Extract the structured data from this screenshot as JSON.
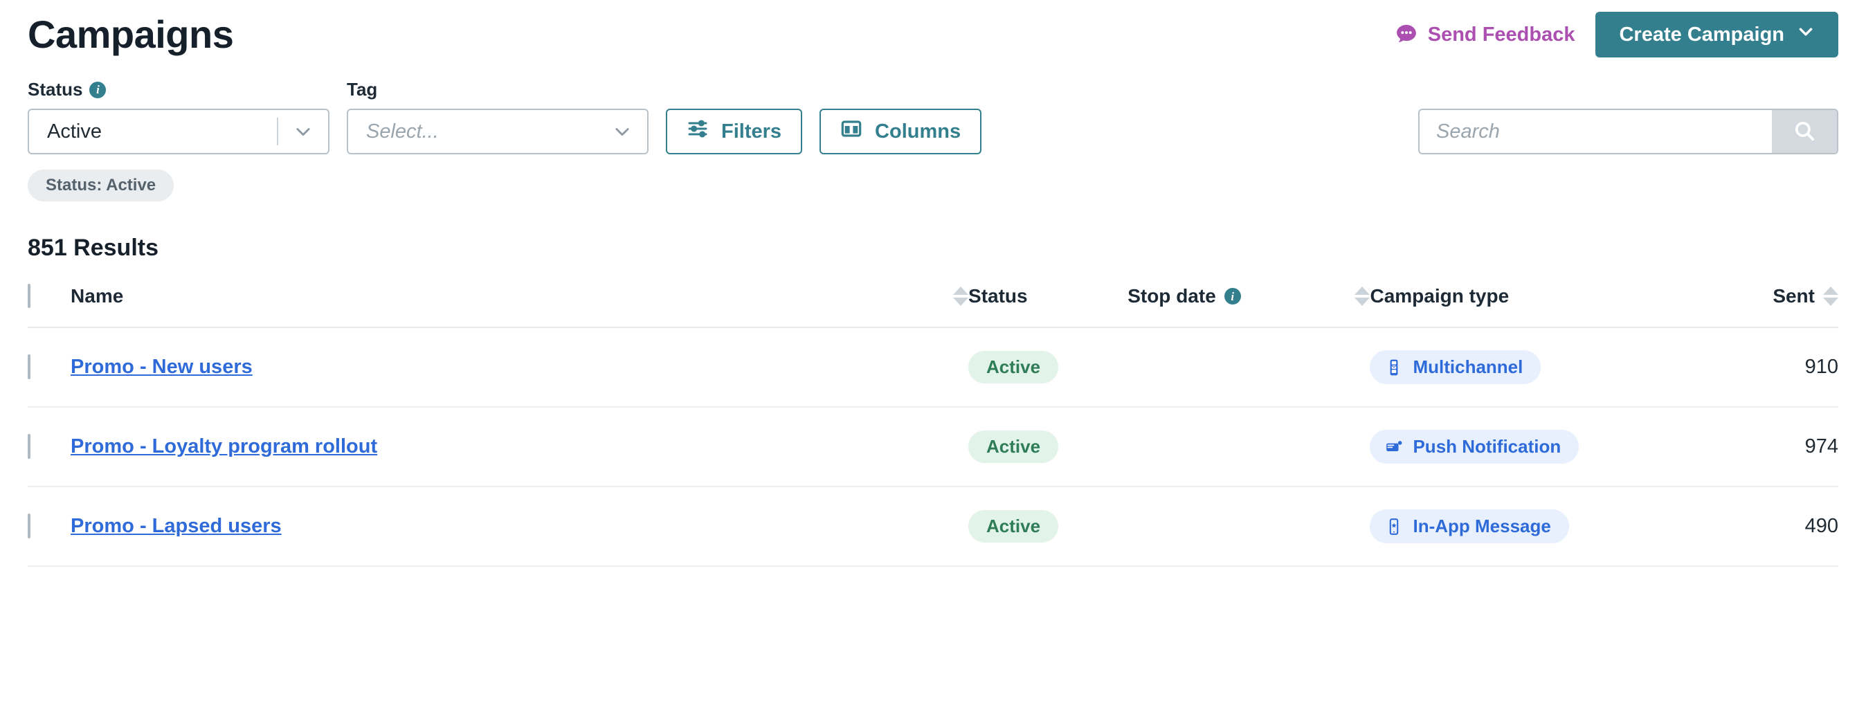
{
  "header": {
    "title": "Campaigns",
    "send_feedback_label": "Send Feedback",
    "create_campaign_label": "Create Campaign"
  },
  "filters": {
    "status": {
      "label": "Status",
      "value": "Active",
      "has_info_icon": true,
      "info_glyph": "i"
    },
    "tag": {
      "label": "Tag",
      "placeholder": "Select...",
      "value": ""
    },
    "filters_button_label": "Filters",
    "columns_button_label": "Columns",
    "search": {
      "placeholder": "Search",
      "value": ""
    },
    "active_chips": [
      {
        "label": "Status: Active"
      }
    ]
  },
  "results": {
    "count_label": "851 Results"
  },
  "table": {
    "columns": [
      {
        "key": "select",
        "label": "",
        "sortable": false,
        "info": false
      },
      {
        "key": "name",
        "label": "Name",
        "sortable": true,
        "info": false
      },
      {
        "key": "status",
        "label": "Status",
        "sortable": false,
        "info": false
      },
      {
        "key": "stop_date",
        "label": "Stop date",
        "sortable": true,
        "info": true
      },
      {
        "key": "campaign_type",
        "label": "Campaign type",
        "sortable": false,
        "info": false
      },
      {
        "key": "sent",
        "label": "Sent",
        "sortable": true,
        "info": false
      }
    ],
    "rows": [
      {
        "name": "Promo - New users",
        "status": "Active",
        "stop_date": "",
        "campaign_type": "Multichannel",
        "campaign_type_icon": "multichannel-icon",
        "sent": "910",
        "selected": false
      },
      {
        "name": "Promo - Loyalty program rollout",
        "status": "Active",
        "stop_date": "",
        "campaign_type": "Push Notification",
        "campaign_type_icon": "push-notification-icon",
        "sent": "974",
        "selected": false
      },
      {
        "name": "Promo - Lapsed users",
        "status": "Active",
        "stop_date": "",
        "campaign_type": "In-App Message",
        "campaign_type_icon": "in-app-message-icon",
        "sent": "490",
        "selected": false
      }
    ]
  },
  "colors": {
    "brand_teal": "#347f8e",
    "feedback_purple": "#ab4fb0",
    "link_blue": "#2f6ad9",
    "badge_blue_bg": "#e8f0fe",
    "status_green": "#2e7d56",
    "status_green_bg": "#e2f3ea",
    "chip_bg": "#eaedef",
    "border_gray": "#b9c2c9"
  }
}
